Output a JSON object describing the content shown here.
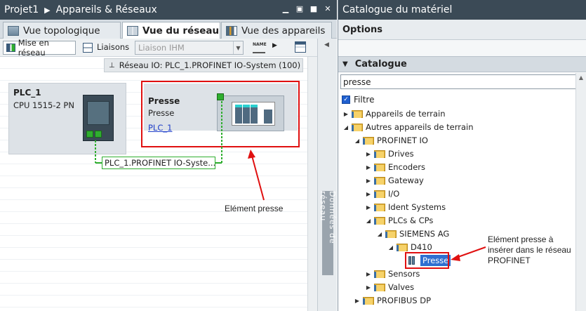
{
  "left_pane": {
    "breadcrumb": [
      "Projet1",
      "Appareils & Réseaux"
    ],
    "window_buttons": [
      "minimize-icon",
      "restore-icon",
      "maximize-icon",
      "close-icon"
    ],
    "tabs": [
      {
        "label": "Vue topologique",
        "active": false,
        "icon": "topology-icon"
      },
      {
        "label": "Vue du réseau",
        "active": true,
        "icon": "network-icon"
      },
      {
        "label": "Vue des appareils",
        "active": false,
        "icon": "devices-icon"
      }
    ],
    "toolbar": {
      "network_button": "Mise en réseau",
      "links_label": "Liaisons",
      "links_select": "Liaison IHM"
    },
    "io_system_label": "Réseau IO: PLC_1.PROFINET IO-System (100)",
    "devices": [
      {
        "name": "PLC_1",
        "type": "CPU 1515-2 PN"
      },
      {
        "name": "Presse",
        "type": "Presse",
        "link": "PLC_1"
      }
    ],
    "network_label": "PLC_1.PROFINET IO-Syste...",
    "side_panel": "Données de réseau",
    "callout": "Elément presse"
  },
  "right_pane": {
    "title": "Catalogue du matériel",
    "options": "Options",
    "catalog": "Catalogue",
    "search_value": "presse",
    "filter_label": "Filtre",
    "tree": [
      {
        "label": "Appareils de terrain",
        "level": 0,
        "expanded": false
      },
      {
        "label": "Autres appareils de terrain",
        "level": 0,
        "expanded": true
      },
      {
        "label": "PROFINET IO",
        "level": 1,
        "expanded": true
      },
      {
        "label": "Drives",
        "level": 2,
        "expanded": false
      },
      {
        "label": "Encoders",
        "level": 2,
        "expanded": false
      },
      {
        "label": "Gateway",
        "level": 2,
        "expanded": false
      },
      {
        "label": "I/O",
        "level": 2,
        "expanded": false
      },
      {
        "label": "Ident Systems",
        "level": 2,
        "expanded": false
      },
      {
        "label": "PLCs & CPs",
        "level": 2,
        "expanded": true
      },
      {
        "label": "SIEMENS AG",
        "level": 3,
        "expanded": true
      },
      {
        "label": "D410",
        "level": 4,
        "expanded": true
      },
      {
        "label": "Presse",
        "level": 5,
        "selected": true
      },
      {
        "label": "Sensors",
        "level": 2,
        "expanded": false
      },
      {
        "label": "Valves",
        "level": 2,
        "expanded": false
      },
      {
        "label": "PROFIBUS DP",
        "level": 1,
        "expanded": false
      }
    ],
    "callout": [
      "Elément presse à",
      "insérer dans le réseau",
      "PROFINET"
    ]
  },
  "colors": {
    "title_bar": "#3b4a56",
    "accent_red": "#e01010",
    "network_green": "#2fae2f",
    "selection_blue": "#2f6fd0"
  }
}
